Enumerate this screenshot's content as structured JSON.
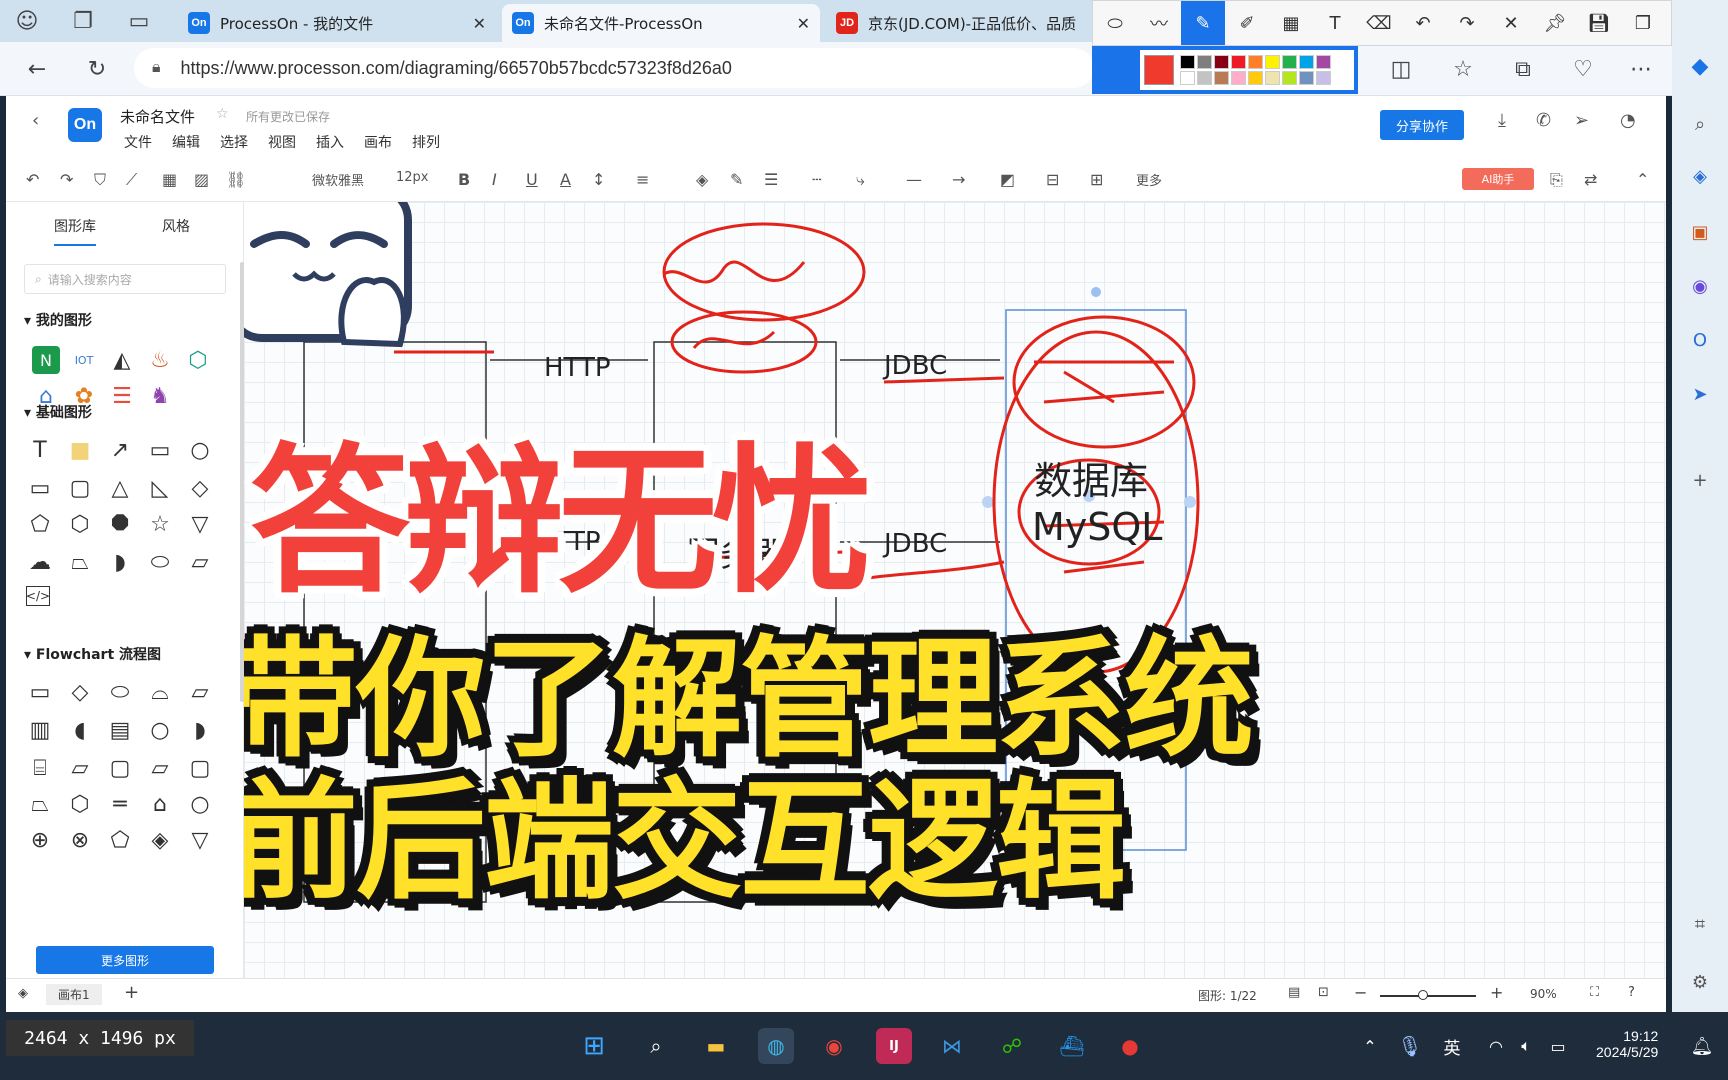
{
  "browser": {
    "tabs": [
      {
        "label": "ProcessOn - 我的文件",
        "favicon": "On"
      },
      {
        "label": "未命名文件-ProcessOn",
        "favicon": "On",
        "active": true
      },
      {
        "label": "京东(JD.COM)-正品低价、品质",
        "favicon": "JD"
      }
    ],
    "url": "https://www.processon.com/diagraming/66570b57bcdc57323f8d26a0"
  },
  "app": {
    "logo": "On",
    "doc_name": "未命名文件",
    "saved_status": "所有更改已保存",
    "menu": [
      "文件",
      "编辑",
      "选择",
      "视图",
      "插入",
      "画布",
      "排列"
    ],
    "share_label": "分享协作",
    "toolbar": {
      "font": "微软雅黑",
      "size": "12px",
      "more": "更多",
      "ai": "AI助手"
    },
    "left_panel": {
      "tabs": [
        "图形库",
        "风格"
      ],
      "search_placeholder": "请输入搜索内容",
      "sections": [
        "我的图形",
        "基础图形",
        "Flowchart 流程图"
      ],
      "more_shapes": "更多图形"
    },
    "status": {
      "page": "画布1",
      "shape_count": "图形: 1/22",
      "zoom": "90%"
    }
  },
  "diagram": {
    "labels": {
      "http_top": "HTTP",
      "jdbc_top": "JDBC",
      "http_bottom": "HTTP",
      "jdbc_bottom": "JDBC",
      "server": "服务器",
      "db_line1": "数据库",
      "db_line2": "MySQL"
    }
  },
  "overlay": {
    "title": "答辩无忧",
    "subtitle_line1": "带你了解管理系统",
    "subtitle_line2": "前后端交互逻辑"
  },
  "os": {
    "dims": "2464 x 1496 px",
    "time": "19:12",
    "date": "2024/5/29",
    "ime": "英"
  }
}
